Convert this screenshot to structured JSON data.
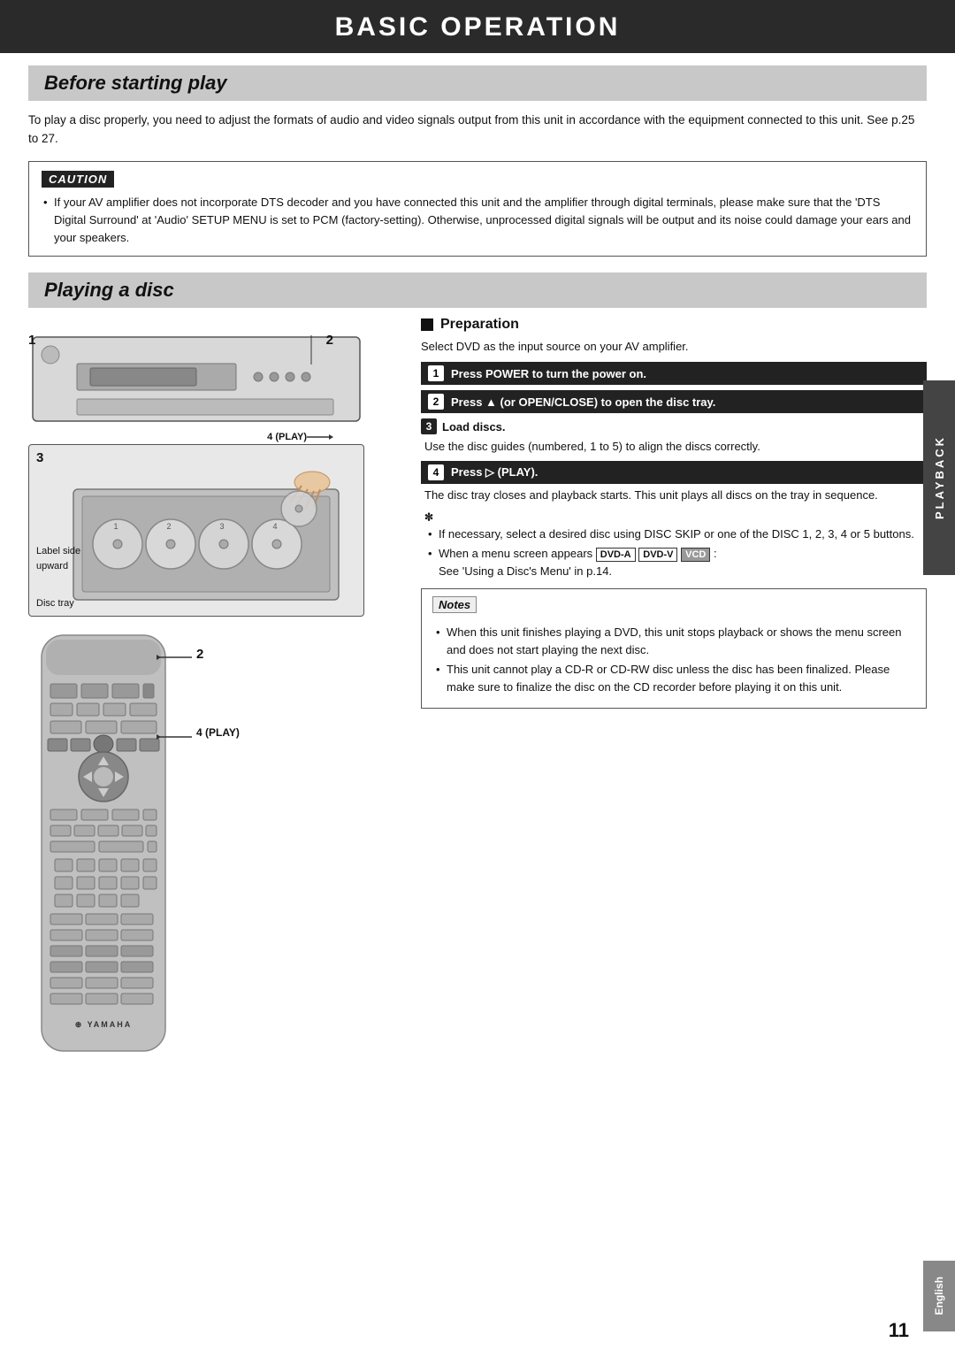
{
  "header": {
    "title": "BASIC OPERATION"
  },
  "sections": {
    "before_starting": {
      "heading": "Before starting play",
      "intro": "To play a disc properly, you need to adjust the formats of audio and video signals output from this unit in accordance with the equipment connected to this unit. See p.25 to 27.",
      "caution": {
        "label": "CAUTION",
        "text": "If your AV amplifier does not incorporate DTS decoder and you have connected this unit and the amplifier through digital terminals, please make sure that the 'DTS Digital Surround' at 'Audio' SETUP MENU is set to PCM (factory-setting). Otherwise, unprocessed digital signals will be output and its noise could damage your ears and your speakers."
      }
    },
    "playing_disc": {
      "heading": "Playing a disc",
      "diagram_labels": {
        "label1": "1",
        "label2": "2",
        "label3": "3",
        "label4_play": "4 (PLAY)",
        "label_side": "Label side\nupward",
        "disc_tray": "Disc tray",
        "remote_label2": "2",
        "remote_label4": "4 (PLAY)"
      },
      "preparation": {
        "heading": "Preparation",
        "select_text": "Select DVD as the input source on your AV amplifier.",
        "steps": [
          {
            "num": "1",
            "bold_text": "Press POWER to turn the power on."
          },
          {
            "num": "2",
            "bold_text": "Press ▲ (or OPEN/CLOSE) to open the disc tray."
          },
          {
            "num": "3",
            "bold_text": "Load discs.",
            "desc": "Use the disc guides (numbered, 1 to 5) to align the discs correctly."
          },
          {
            "num": "4",
            "bold_text": "Press ▷ (PLAY).",
            "desc": "The disc tray closes and playback starts. This unit plays all discs on the tray in sequence."
          }
        ],
        "tip_bullets": [
          "If necessary, select a desired disc using DISC SKIP or one of the DISC 1, 2, 3, 4 or 5 buttons.",
          "When a menu screen appears DVD-A  DVD-V  VCD : See 'Using a Disc's Menu' in p.14."
        ],
        "notes_label": "Notes",
        "notes": [
          "When this unit finishes playing a DVD, this unit stops playback or shows the menu screen and does not start playing the next disc.",
          "This unit cannot play a CD-R or CD-RW disc unless the disc has been finalized. Please make sure to finalize the disc on the CD recorder before playing it on this unit."
        ]
      }
    }
  },
  "sidebar": {
    "playback_label": "PLAYBACK",
    "english_label": "English"
  },
  "page_number": "11"
}
